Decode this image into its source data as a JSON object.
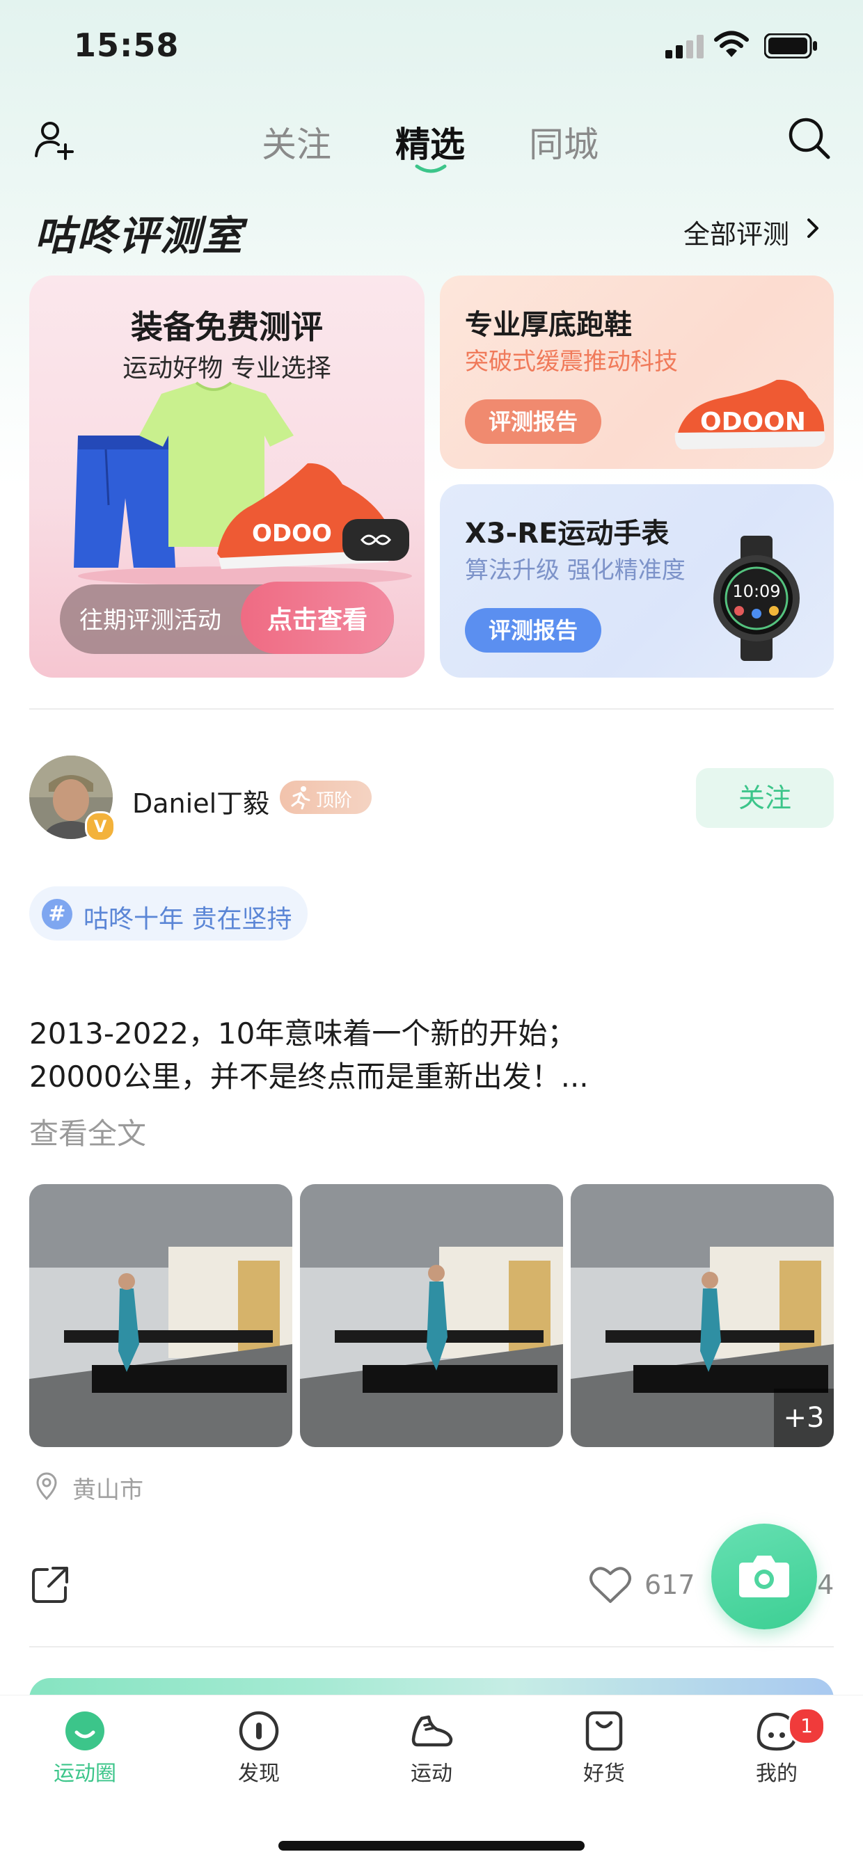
{
  "status_bar": {
    "time": "15:58"
  },
  "nav": {
    "tabs": [
      {
        "label": "关注"
      },
      {
        "label": "精选"
      },
      {
        "label": "同城"
      }
    ],
    "active_tab": "精选",
    "accent_color": "#3cc58a"
  },
  "review_section": {
    "title": "咕咚评测室",
    "all_link": "全部评测",
    "main_card": {
      "title": "装备免费测评",
      "subtitle": "运动好物 专业选择",
      "past_activities": "往期评测活动",
      "view_button": "点击查看"
    },
    "cards": [
      {
        "title": "专业厚底跑鞋",
        "subtitle": "突破式缓震推动科技",
        "button": "评测报告"
      },
      {
        "title": "X3-RE运动手表",
        "subtitle": "算法升级 强化精准度",
        "button": "评测报告",
        "watch_time": "10:09"
      }
    ]
  },
  "post": {
    "username": "Daniel丁毅",
    "level": "顶阶",
    "verified_mark": "V",
    "follow_button": "关注",
    "topic": "咕咚十年 贵在坚持",
    "topic_symbol": "#",
    "lines": [
      "2013-2022，10年意味着一个新的开始；",
      "20000公里，并不是终点而是重新出发！..."
    ],
    "read_more": "查看全文",
    "extra_photos": "+3",
    "location": "黄山市",
    "likes": "617",
    "comments": "34"
  },
  "tabbar": {
    "items": [
      {
        "label": "运动圈",
        "icon": "sport-circle-icon"
      },
      {
        "label": "发现",
        "icon": "discover-icon"
      },
      {
        "label": "运动",
        "icon": "shoe-icon"
      },
      {
        "label": "好货",
        "icon": "shopping-bag-icon"
      },
      {
        "label": "我的",
        "icon": "profile-icon"
      }
    ],
    "active": "运动圈",
    "my_badge": "1"
  }
}
